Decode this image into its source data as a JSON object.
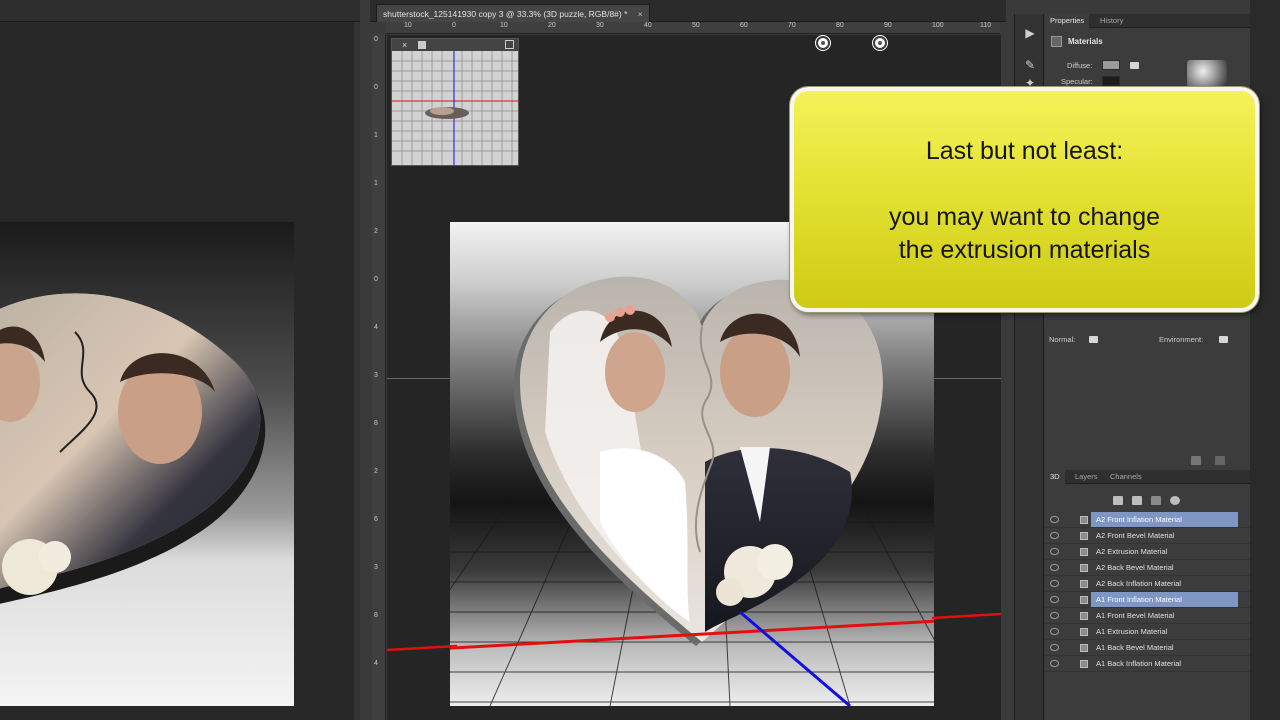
{
  "document": {
    "tab_title": "shutterstock_125141930 copy 3 @ 33.3% (3D puzzle, RGB/8#) *",
    "close_glyph": "×",
    "ruler_top_labels": [
      "10",
      "0",
      "10",
      "20",
      "30",
      "40",
      "50",
      "60",
      "70",
      "80",
      "90",
      "100",
      "110"
    ],
    "ruler_left_labels": [
      "0",
      "0",
      "1",
      "1",
      "2",
      "0",
      "4",
      "3",
      "8",
      "2",
      "6",
      "3",
      "8",
      "4"
    ]
  },
  "callout": {
    "line1": "Last but not least:",
    "line2": "you may want to change",
    "line3": "the extrusion materials"
  },
  "properties_panel": {
    "tabs": [
      "Properties",
      "History"
    ],
    "header": "Materials",
    "diffuse_label": "Diffuse:",
    "specular_label": "Specular:",
    "normal_label": "Normal:",
    "environment_label": "Environment:"
  },
  "layers_panel": {
    "tabs": [
      "3D",
      "Layers",
      "Channels"
    ],
    "items": [
      {
        "label": "A2 Front Inflation Material",
        "selected": true
      },
      {
        "label": "A2 Front Bevel Material",
        "selected": false
      },
      {
        "label": "A2 Extrusion Material",
        "selected": false
      },
      {
        "label": "A2 Back Bevel Material",
        "selected": false
      },
      {
        "label": "A2 Back Inflation Material",
        "selected": false
      },
      {
        "label": "A1 Front Inflation Material",
        "selected": true
      },
      {
        "label": "A1 Front Bevel Material",
        "selected": false
      },
      {
        "label": "A1 Extrusion Material",
        "selected": false
      },
      {
        "label": "A1 Back Bevel Material",
        "selected": false
      },
      {
        "label": "A1 Back Inflation Material",
        "selected": false
      }
    ]
  },
  "icons": {
    "play": "▶",
    "tool2": "✎",
    "tool3": "✦"
  },
  "colors": {
    "callout_yellow": "#e4e232",
    "selection_blue": "#7d96c4",
    "axis_red": "#e01010",
    "axis_blue": "#1010e0"
  }
}
